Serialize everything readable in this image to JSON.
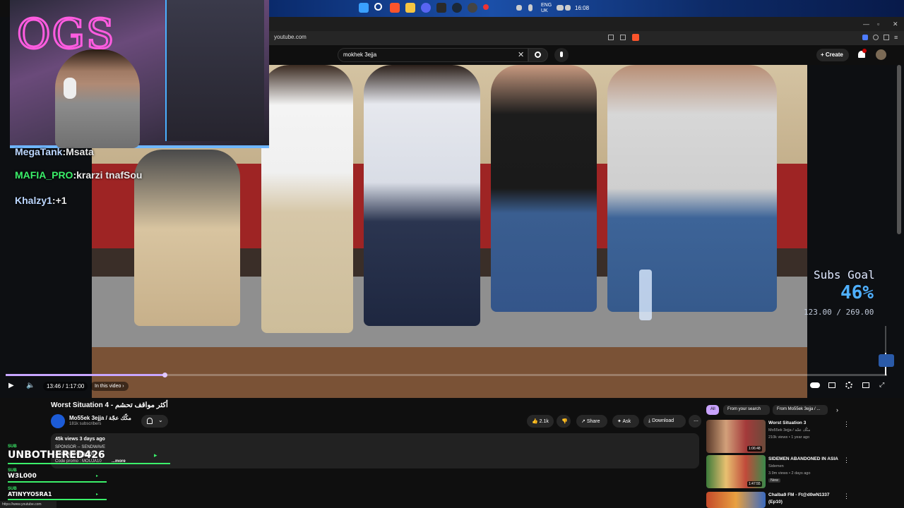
{
  "taskbar": {
    "lang": "ENG",
    "region": "UK",
    "time": "16:08"
  },
  "browser": {
    "url": "youtube.com",
    "status_url": "https://www.youtube.com"
  },
  "search": {
    "value": "mokhek 3ejja"
  },
  "masthead": {
    "create_label": "Create"
  },
  "chat": [
    {
      "user": "MegaTank",
      "message": ":Msata"
    },
    {
      "user": "MAFIA_PRO",
      "message": ":krarzi tnafSou"
    },
    {
      "user": "Khalzy1",
      "message": ":+1"
    }
  ],
  "subs_goal": {
    "title": "Subs Goal",
    "percent": "46%",
    "count": "123.00 / 269.00",
    "progress": 0.46
  },
  "player": {
    "time": "13:46 / 1:17:00",
    "in_video": "In this video",
    "progress": 0.18
  },
  "video": {
    "title": "Worst Situation 4 - أكثر مواقف تحشم",
    "channel": "Mo55ek 3ejja / مكّك عجّة",
    "subscribers": "181k subscribers",
    "likes": "2.1k",
    "share": "Share",
    "ask": "Ask",
    "download": "Download",
    "views_date": "45k views  3 days ago",
    "desc_line1": "SPONSOR -- SENDWAVE",
    "desc_line2": "...com/kjap/qfpgds00",
    "desc_line3": "Code promo : MOUJA10",
    "more": "...more"
  },
  "subs_alerts": [
    {
      "label": "SUB",
      "name": "UNBOTHERED426"
    },
    {
      "label": "SUB",
      "name": "W3L000"
    },
    {
      "label": "SUB",
      "name": "ATINYYOSRA1"
    }
  ],
  "chips": [
    "All",
    "From your search",
    "From Mo55ek 3ejja / ..."
  ],
  "recommendations": [
    {
      "title": "Worst Situation 3",
      "channel": "Mo55ek 3ejja / مكّك عجّة",
      "meta": "210k views • 1 year ago",
      "duration": "1:06:48",
      "color": "#7a5a3a"
    },
    {
      "title": "SIDEMEN ABANDONED IN ASIA",
      "channel": "Sidemen",
      "meta": "3.9m views • 2 days ago",
      "badge": "New",
      "duration": "1:47:55",
      "color": "#3f8a3a"
    },
    {
      "title": "Chalba9 FM - Ft@d0wN1337",
      "channel": "(Ep10)",
      "meta": "",
      "duration": "",
      "color": "#c44a2a"
    }
  ]
}
